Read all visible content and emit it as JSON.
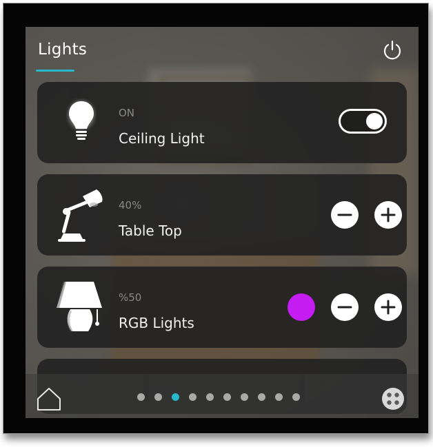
{
  "header": {
    "title": "Lights",
    "power_icon": "power-icon"
  },
  "cards": [
    {
      "icon": "bulb-icon",
      "status": "ON",
      "name": "Ceiling Light",
      "control": "toggle",
      "toggle_on": true
    },
    {
      "icon": "desk-lamp-icon",
      "status": "40%",
      "name": "Table Top",
      "control": "stepper",
      "brightness_percent": 40
    },
    {
      "icon": "table-lamp-icon",
      "status": "%50",
      "name": "RGB Lights",
      "control": "stepper-with-color",
      "brightness_percent": 50,
      "color": "#c51cf2"
    }
  ],
  "footer": {
    "home_icon": "home-icon",
    "apps_icon": "apps-icon",
    "page_count": 10,
    "active_page": 3
  },
  "colors": {
    "accent": "#27b8cc",
    "card_bg": "#202020",
    "text_primary": "#f2f2f2",
    "text_secondary": "#8a8a8a"
  }
}
